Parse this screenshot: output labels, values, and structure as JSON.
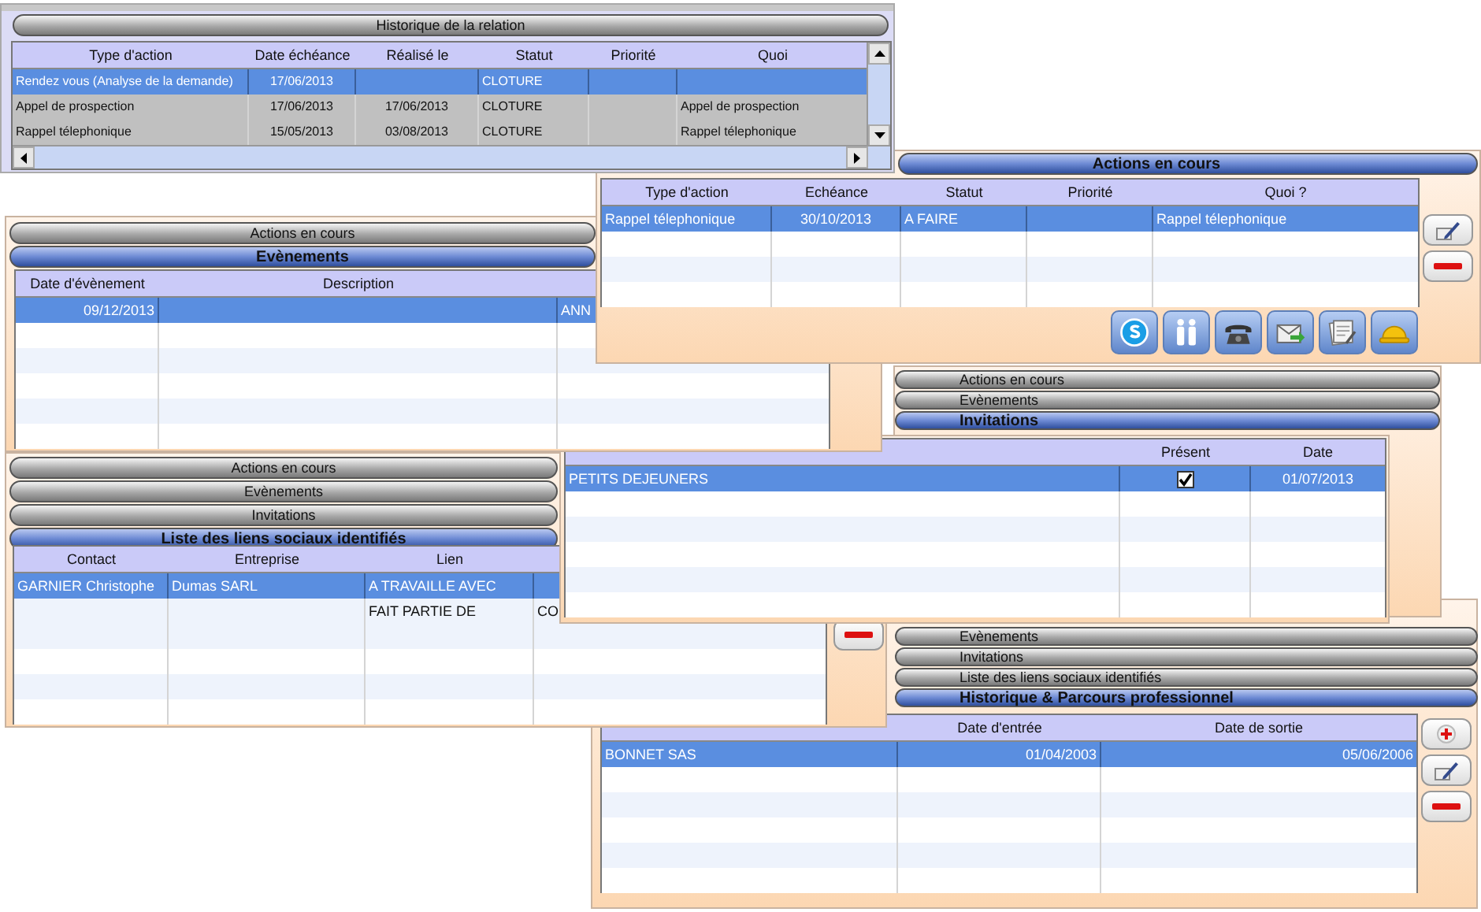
{
  "relation_history": {
    "title": "Historique de la relation",
    "columns": [
      "Type d'action",
      "Date échéance",
      "Réalisé le",
      "Statut",
      "Priorité",
      "Quoi"
    ],
    "rows": [
      {
        "selected": true,
        "cells": [
          "Rendez vous (Analyse de la demande)",
          "17/06/2013",
          null,
          "CLOTURE",
          null,
          null
        ]
      },
      {
        "selected": false,
        "cells": [
          "Appel de prospection",
          "17/06/2013",
          "17/06/2013",
          "CLOTURE",
          null,
          "Appel de prospection"
        ]
      },
      {
        "selected": false,
        "cells": [
          "Rappel télephonique",
          "15/05/2013",
          "03/08/2013",
          "CLOTURE",
          null,
          "Rappel télephonique"
        ]
      }
    ]
  },
  "current_actions": {
    "title": "Actions en cours",
    "columns": [
      "Type d'action",
      "Echéance",
      "Statut",
      "Priorité",
      "Quoi ?"
    ],
    "rows": [
      {
        "selected": true,
        "cells": [
          "Rappel télephonique",
          "30/10/2013",
          "A FAIRE",
          null,
          "Rappel télephonique"
        ]
      }
    ],
    "buttons": [
      {
        "kind": "edit"
      },
      {
        "kind": "remove"
      }
    ],
    "toolbar": [
      {
        "kind": "skype"
      },
      {
        "kind": "contacts"
      },
      {
        "kind": "phone"
      },
      {
        "kind": "mail"
      },
      {
        "kind": "notes"
      },
      {
        "kind": "helmet"
      }
    ]
  },
  "events_panel": {
    "sections": [
      {
        "label": "Actions en cours",
        "selected": false
      },
      {
        "label": "Evènements",
        "selected": true
      }
    ],
    "columns": [
      "Date d'évènement",
      "Description",
      null
    ],
    "rows": [
      {
        "selected": true,
        "cells": [
          "09/12/2013",
          null,
          "ANN"
        ]
      }
    ]
  },
  "invitations_panel": {
    "sections": [
      {
        "label": "Actions en cours",
        "selected": false
      },
      {
        "label": "Evènements",
        "selected": false
      },
      {
        "label": "Invitations",
        "selected": true
      }
    ],
    "columns": [
      null,
      "Présent",
      "Date"
    ],
    "rows": [
      {
        "selected": true,
        "event": "PETITS DEJEUNERS",
        "present": true,
        "date": "01/07/2013"
      }
    ]
  },
  "social_links_panel": {
    "sections": [
      {
        "label": "Actions en cours",
        "selected": false
      },
      {
        "label": "Evènements",
        "selected": false
      },
      {
        "label": "Invitations",
        "selected": false
      },
      {
        "label": "Liste des liens sociaux identifiés",
        "selected": true
      }
    ],
    "columns": [
      "Contact",
      "Entreprise",
      "Lien",
      null
    ],
    "rows": [
      {
        "selected": true,
        "cells": [
          "GARNIER Christophe",
          "Dumas SARL",
          "A TRAVAILLE AVEC",
          null
        ]
      },
      {
        "selected": false,
        "cells": [
          null,
          null,
          "FAIT PARTIE DE",
          "CO"
        ]
      }
    ],
    "buttons": [
      {
        "kind": "remove"
      }
    ]
  },
  "career_panel": {
    "sections": [
      {
        "label": "Evènements",
        "selected": false
      },
      {
        "label": "Invitations",
        "selected": false
      },
      {
        "label": "Liste des liens sociaux identifiés",
        "selected": false
      },
      {
        "label": "Historique & Parcours professionnel",
        "selected": true
      }
    ],
    "columns": [
      null,
      "Date d'entrée",
      "Date de sortie"
    ],
    "rows": [
      {
        "selected": true,
        "cells": [
          "BONNET SAS",
          "01/04/2003",
          "05/06/2006"
        ]
      }
    ],
    "buttons": [
      {
        "kind": "add"
      },
      {
        "kind": "edit"
      },
      {
        "kind": "remove"
      }
    ]
  }
}
